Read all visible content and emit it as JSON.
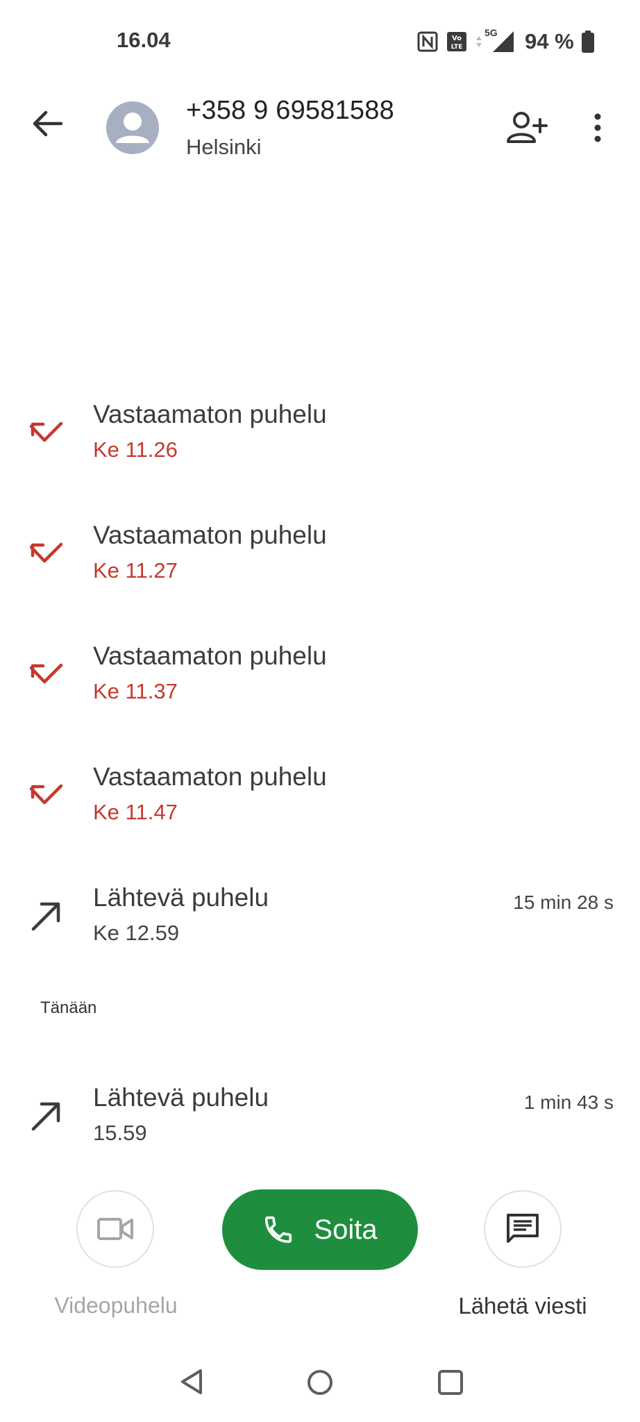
{
  "status_bar": {
    "time": "16.04",
    "battery": "94 %",
    "network": "5G",
    "icons": [
      "nfc-icon",
      "volte-icon",
      "data-arrows-icon",
      "signal-icon",
      "battery-icon"
    ]
  },
  "header": {
    "phone_number": "+358 9 69581588",
    "location": "Helsinki"
  },
  "calls": [
    {
      "type": "missed",
      "title": "Vastaamaton puhelu",
      "time": "Ke 11.26",
      "duration": ""
    },
    {
      "type": "missed",
      "title": "Vastaamaton puhelu",
      "time": "Ke 11.27",
      "duration": ""
    },
    {
      "type": "missed",
      "title": "Vastaamaton puhelu",
      "time": "Ke 11.37",
      "duration": ""
    },
    {
      "type": "missed",
      "title": "Vastaamaton puhelu",
      "time": "Ke 11.47",
      "duration": ""
    },
    {
      "type": "outgoing",
      "title": "Lähtevä puhelu",
      "time": "Ke 12.59",
      "duration": "15 min 28 s"
    }
  ],
  "today_section": {
    "header": "Tänään",
    "calls": [
      {
        "type": "outgoing",
        "title": "Lähtevä puhelu",
        "time": "15.59",
        "duration": "1 min 43 s"
      }
    ]
  },
  "actions": {
    "video_label": "Videopuhelu",
    "call_label": "Soita",
    "message_label": "Lähetä viesti"
  },
  "colors": {
    "missed": "#c5392d",
    "call_button": "#1e8e3e",
    "avatar": "#a7afc3",
    "disabled_text": "#a6a6a6"
  }
}
